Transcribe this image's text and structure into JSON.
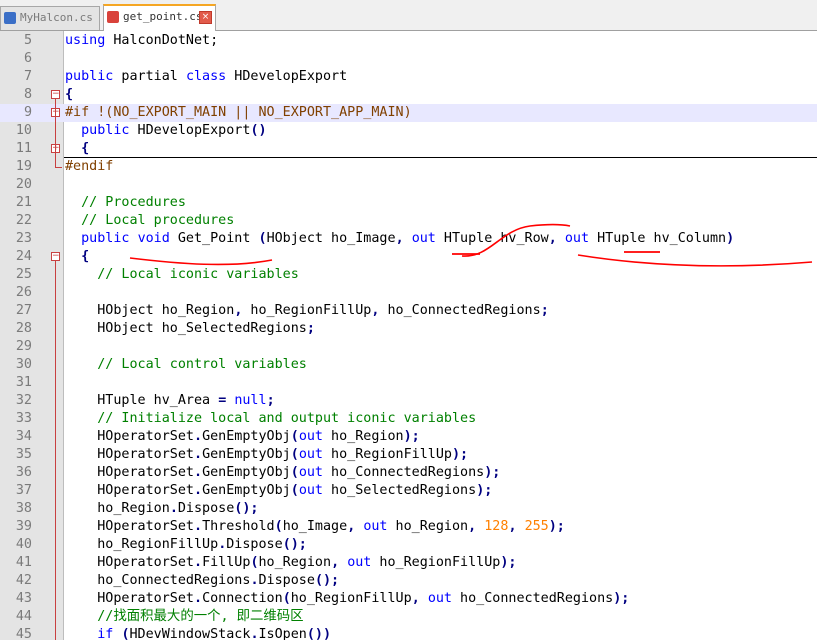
{
  "tabs": [
    {
      "label": "MyHalcon.cs",
      "active": false,
      "icon": "save-file-icon",
      "icon_color": "#3b6fc7"
    },
    {
      "label": "get_point.cs",
      "active": true,
      "icon": "modified-file-icon",
      "icon_color": "#d9423b"
    }
  ],
  "colors": {
    "keyword": "#0000ff",
    "comment": "#008000",
    "number": "#ff8000",
    "operator": "#000080",
    "preprocessor": "#804000",
    "annotation": "#ff0000"
  },
  "lines": [
    {
      "num": "5",
      "fold": null,
      "tokens": [
        [
          "k",
          "using"
        ],
        [
          "t",
          " HalconDotNet;"
        ]
      ]
    },
    {
      "num": "6",
      "fold": null,
      "tokens": []
    },
    {
      "num": "7",
      "fold": null,
      "tokens": [
        [
          "k",
          "public"
        ],
        [
          "t",
          " partial "
        ],
        [
          "k",
          "class"
        ],
        [
          "t",
          " HDevelopExport"
        ]
      ]
    },
    {
      "num": "8",
      "fold": "minus",
      "tokens": [
        [
          "p",
          "{"
        ]
      ]
    },
    {
      "num": "9",
      "fold": "minus",
      "highlight": true,
      "tokens": [
        [
          "pre",
          "#if !(NO_EXPORT_MAIN || NO_EXPORT_APP_MAIN)"
        ]
      ]
    },
    {
      "num": "10",
      "fold": null,
      "tokens": [
        [
          "t",
          "  "
        ],
        [
          "k",
          "public"
        ],
        [
          "t",
          " HDevelopExport"
        ],
        [
          "p",
          "()"
        ]
      ]
    },
    {
      "num": "11",
      "fold": "plus",
      "tokens": [
        [
          "t",
          "  "
        ],
        [
          "p",
          "{"
        ]
      ]
    },
    {
      "num": "19",
      "fold": "end",
      "tokens": [
        [
          "pre",
          "#endif"
        ]
      ]
    },
    {
      "num": "20",
      "fold": null,
      "tokens": []
    },
    {
      "num": "21",
      "fold": null,
      "tokens": [
        [
          "t",
          "  "
        ],
        [
          "c",
          "// Procedures"
        ]
      ]
    },
    {
      "num": "22",
      "fold": null,
      "tokens": [
        [
          "t",
          "  "
        ],
        [
          "c",
          "// Local procedures"
        ]
      ]
    },
    {
      "num": "23",
      "fold": null,
      "tokens": [
        [
          "t",
          "  "
        ],
        [
          "k",
          "public"
        ],
        [
          "t",
          " "
        ],
        [
          "k",
          "void"
        ],
        [
          "t",
          " Get_Point "
        ],
        [
          "p",
          "("
        ],
        [
          "t",
          "HObject ho_Image"
        ],
        [
          "p",
          ","
        ],
        [
          "t",
          " "
        ],
        [
          "k",
          "out"
        ],
        [
          "t",
          " HTuple hv_Row"
        ],
        [
          "p",
          ","
        ],
        [
          "t",
          " "
        ],
        [
          "k",
          "out"
        ],
        [
          "t",
          " HTuple hv_Column"
        ],
        [
          "p",
          ")"
        ]
      ]
    },
    {
      "num": "24",
      "fold": "minus",
      "tokens": [
        [
          "t",
          "  "
        ],
        [
          "p",
          "{"
        ]
      ]
    },
    {
      "num": "25",
      "fold": null,
      "tokens": [
        [
          "t",
          "    "
        ],
        [
          "c",
          "// Local iconic variables"
        ]
      ]
    },
    {
      "num": "26",
      "fold": null,
      "tokens": []
    },
    {
      "num": "27",
      "fold": null,
      "tokens": [
        [
          "t",
          "    HObject ho_Region"
        ],
        [
          "p",
          ","
        ],
        [
          "t",
          " ho_RegionFillUp"
        ],
        [
          "p",
          ","
        ],
        [
          "t",
          " ho_ConnectedRegions"
        ],
        [
          "p",
          ";"
        ]
      ]
    },
    {
      "num": "28",
      "fold": null,
      "tokens": [
        [
          "t",
          "    HObject ho_SelectedRegions"
        ],
        [
          "p",
          ";"
        ]
      ]
    },
    {
      "num": "29",
      "fold": null,
      "tokens": []
    },
    {
      "num": "30",
      "fold": null,
      "tokens": [
        [
          "t",
          "    "
        ],
        [
          "c",
          "// Local control variables"
        ]
      ]
    },
    {
      "num": "31",
      "fold": null,
      "tokens": []
    },
    {
      "num": "32",
      "fold": null,
      "tokens": [
        [
          "t",
          "    HTuple hv_Area "
        ],
        [
          "p",
          "="
        ],
        [
          "t",
          " "
        ],
        [
          "k",
          "null"
        ],
        [
          "p",
          ";"
        ]
      ]
    },
    {
      "num": "33",
      "fold": null,
      "tokens": [
        [
          "t",
          "    "
        ],
        [
          "c",
          "// Initialize local and output iconic variables"
        ]
      ]
    },
    {
      "num": "34",
      "fold": null,
      "tokens": [
        [
          "t",
          "    HOperatorSet"
        ],
        [
          "p",
          "."
        ],
        [
          "t",
          "GenEmptyObj"
        ],
        [
          "p",
          "("
        ],
        [
          "k",
          "out"
        ],
        [
          "t",
          " ho_Region"
        ],
        [
          "p",
          ");"
        ]
      ]
    },
    {
      "num": "35",
      "fold": null,
      "tokens": [
        [
          "t",
          "    HOperatorSet"
        ],
        [
          "p",
          "."
        ],
        [
          "t",
          "GenEmptyObj"
        ],
        [
          "p",
          "("
        ],
        [
          "k",
          "out"
        ],
        [
          "t",
          " ho_RegionFillUp"
        ],
        [
          "p",
          ");"
        ]
      ]
    },
    {
      "num": "36",
      "fold": null,
      "tokens": [
        [
          "t",
          "    HOperatorSet"
        ],
        [
          "p",
          "."
        ],
        [
          "t",
          "GenEmptyObj"
        ],
        [
          "p",
          "("
        ],
        [
          "k",
          "out"
        ],
        [
          "t",
          " ho_ConnectedRegions"
        ],
        [
          "p",
          ");"
        ]
      ]
    },
    {
      "num": "37",
      "fold": null,
      "tokens": [
        [
          "t",
          "    HOperatorSet"
        ],
        [
          "p",
          "."
        ],
        [
          "t",
          "GenEmptyObj"
        ],
        [
          "p",
          "("
        ],
        [
          "k",
          "out"
        ],
        [
          "t",
          " ho_SelectedRegions"
        ],
        [
          "p",
          ");"
        ]
      ]
    },
    {
      "num": "38",
      "fold": null,
      "tokens": [
        [
          "t",
          "    ho_Region"
        ],
        [
          "p",
          "."
        ],
        [
          "t",
          "Dispose"
        ],
        [
          "p",
          "();"
        ]
      ]
    },
    {
      "num": "39",
      "fold": null,
      "tokens": [
        [
          "t",
          "    HOperatorSet"
        ],
        [
          "p",
          "."
        ],
        [
          "t",
          "Threshold"
        ],
        [
          "p",
          "("
        ],
        [
          "t",
          "ho_Image"
        ],
        [
          "p",
          ","
        ],
        [
          "t",
          " "
        ],
        [
          "k",
          "out"
        ],
        [
          "t",
          " ho_Region"
        ],
        [
          "p",
          ","
        ],
        [
          "t",
          " "
        ],
        [
          "n",
          "128"
        ],
        [
          "p",
          ","
        ],
        [
          "t",
          " "
        ],
        [
          "n",
          "255"
        ],
        [
          "p",
          ");"
        ]
      ]
    },
    {
      "num": "40",
      "fold": null,
      "tokens": [
        [
          "t",
          "    ho_RegionFillUp"
        ],
        [
          "p",
          "."
        ],
        [
          "t",
          "Dispose"
        ],
        [
          "p",
          "();"
        ]
      ]
    },
    {
      "num": "41",
      "fold": null,
      "tokens": [
        [
          "t",
          "    HOperatorSet"
        ],
        [
          "p",
          "."
        ],
        [
          "t",
          "FillUp"
        ],
        [
          "p",
          "("
        ],
        [
          "t",
          "ho_Region"
        ],
        [
          "p",
          ","
        ],
        [
          "t",
          " "
        ],
        [
          "k",
          "out"
        ],
        [
          "t",
          " ho_RegionFillUp"
        ],
        [
          "p",
          ");"
        ]
      ]
    },
    {
      "num": "42",
      "fold": null,
      "tokens": [
        [
          "t",
          "    ho_ConnectedRegions"
        ],
        [
          "p",
          "."
        ],
        [
          "t",
          "Dispose"
        ],
        [
          "p",
          "();"
        ]
      ]
    },
    {
      "num": "43",
      "fold": null,
      "tokens": [
        [
          "t",
          "    HOperatorSet"
        ],
        [
          "p",
          "."
        ],
        [
          "t",
          "Connection"
        ],
        [
          "p",
          "("
        ],
        [
          "t",
          "ho_RegionFillUp"
        ],
        [
          "p",
          ","
        ],
        [
          "t",
          " "
        ],
        [
          "k",
          "out"
        ],
        [
          "t",
          " ho_ConnectedRegions"
        ],
        [
          "p",
          ");"
        ]
      ]
    },
    {
      "num": "44",
      "fold": null,
      "tokens": [
        [
          "t",
          "    "
        ],
        [
          "c",
          "//找面积最大的一个, 即二维码区"
        ]
      ]
    },
    {
      "num": "45",
      "fold": null,
      "tokens": [
        [
          "t",
          "    "
        ],
        [
          "k",
          "if"
        ],
        [
          "t",
          " "
        ],
        [
          "p",
          "("
        ],
        [
          "t",
          "HDevWindowStack"
        ],
        [
          "p",
          "."
        ],
        [
          "t",
          "IsOpen"
        ],
        [
          "p",
          "())"
        ]
      ]
    }
  ]
}
